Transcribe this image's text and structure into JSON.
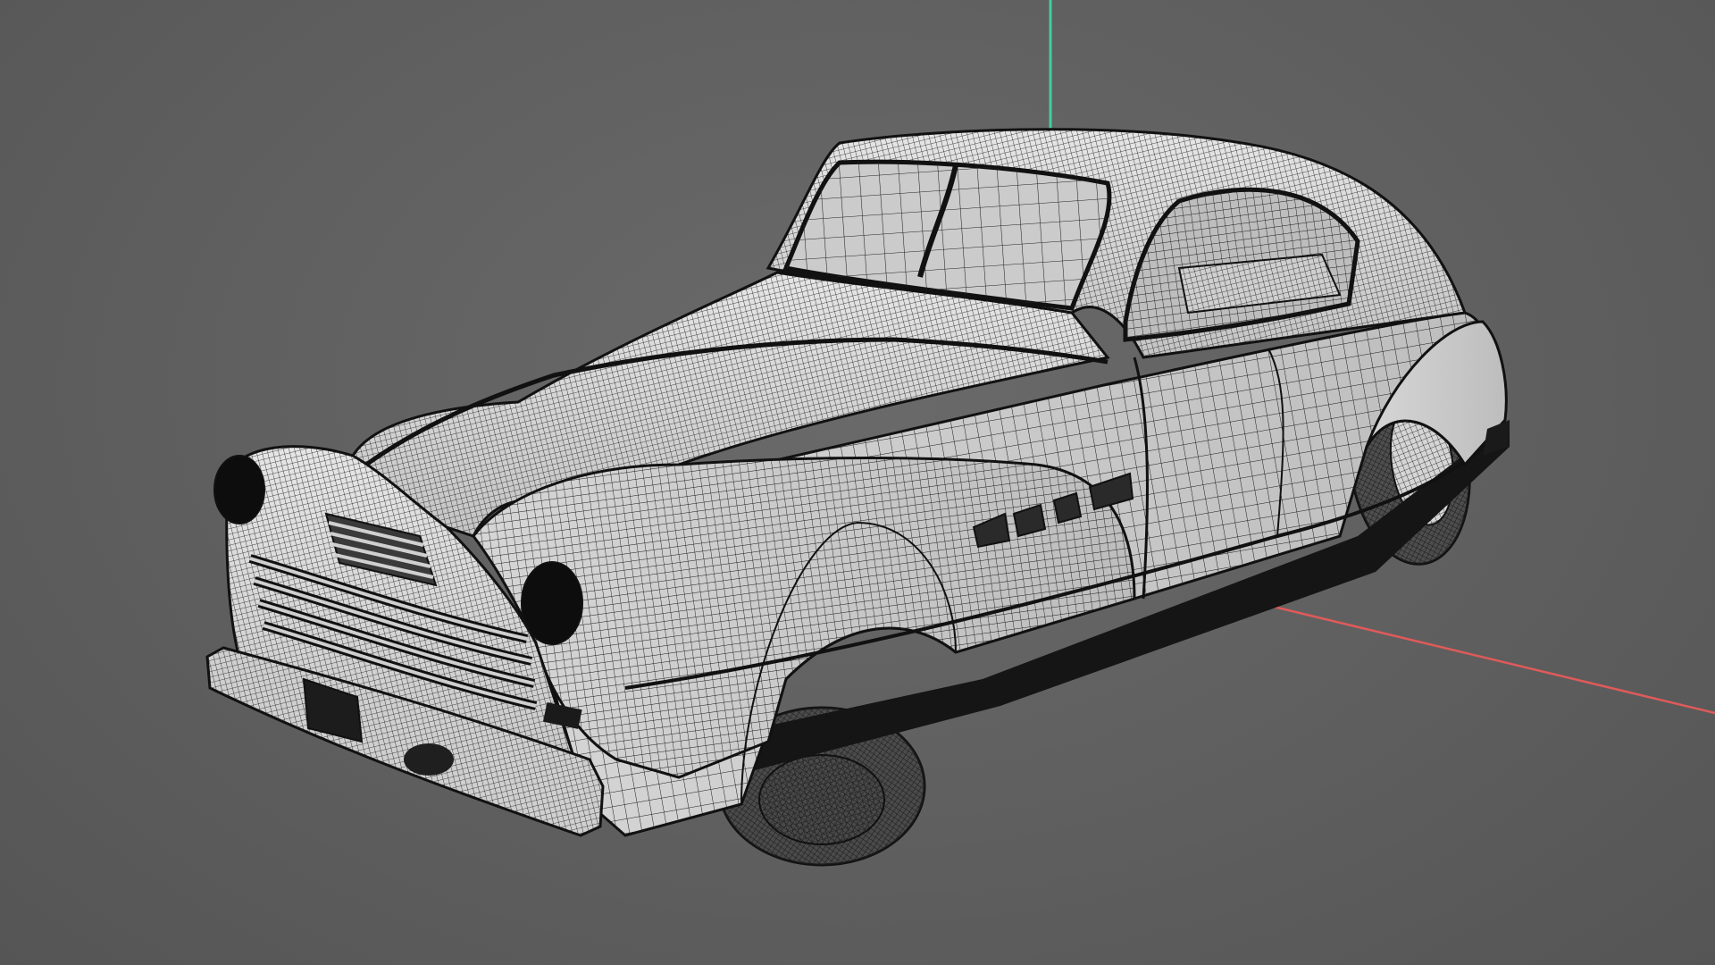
{
  "viewport": {
    "background": "#5f5f5f",
    "display_mode": "wireframe-on-shaded",
    "axes": {
      "x_axis_color": "#e05a5a",
      "y_axis_color": "#3fd0a0"
    },
    "model": {
      "body_color": "#d8d8d8",
      "wire_color": "#1a1a1a",
      "glass_color": "#c9c9c9",
      "shadow_color": "#0f0f0f"
    }
  }
}
